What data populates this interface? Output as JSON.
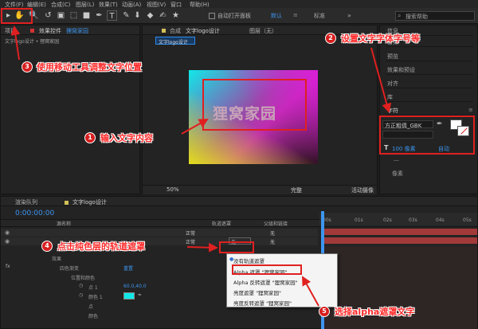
{
  "menubar": {
    "items": [
      "文件(F)",
      "编辑(E)",
      "合成(C)",
      "图层(L)",
      "效果(T)",
      "动画(A)",
      "视图(V)",
      "窗口",
      "帮助(H)"
    ]
  },
  "toolbar": {
    "auto_open_label": "自动打开面板",
    "workspace_default": "默认",
    "workspace_standard": "标准",
    "search_placeholder": "搜索帮助"
  },
  "project_panel": {
    "tab_project": "项目",
    "tab_effects": "效果控件",
    "tab_effects_target": "狸窝家园",
    "item": "文字logo设计 • 狸窝家园"
  },
  "comp_panel": {
    "tab": "合成",
    "comp_name": "文字logo设计",
    "layer_tab": "图层（无）",
    "breadcrumb": "文字logo设计",
    "canvas_text": "狸窝家园",
    "zoom": "50%",
    "quality": "完整",
    "camera": "活动摄像"
  },
  "right_panel": {
    "items": [
      "信息",
      "音频",
      "预览",
      "效果和预设",
      "对齐",
      "库"
    ],
    "char_title": "字符",
    "font_name": "方正粗倩_GBK",
    "font_size": "100 像素",
    "leading": "自动",
    "kerning_unit": "像素"
  },
  "timeline": {
    "tab_render": "渲染队列",
    "tab_comp": "文字logo设计",
    "timecode": "0:00:00:00",
    "col_source": "源名称",
    "col_trkmat": "轨道遮罩",
    "col_parent": "父级和链接",
    "mode_normal": "正常",
    "trkmat_none": "无",
    "parent_none": "无",
    "row_effect": "效果",
    "row_four_color": "四色渐变",
    "row_reset": "重置",
    "row_pos_color": "位置和颜色",
    "row_point1": "点 1",
    "row_point1_val": "60.0,40.0",
    "row_color1": "颜色 1",
    "row_point_short": "点",
    "row_color_short": "颜色",
    "ruler": [
      "00s",
      "01s",
      "02s",
      "03s",
      "04s",
      "05s"
    ]
  },
  "trkmat_menu": {
    "items": [
      "没有轨道遮罩",
      "Alpha 遮罩 \"狸窝家园\"",
      "Alpha 反转遮罩 \"狸窝家园\"",
      "亮度遮罩 \"狸窝家园\"",
      "亮度反转遮罩 \"狸窝家园\""
    ]
  },
  "annotations": {
    "a1": "输入文字内容",
    "a2": "设置文字字体字号等",
    "a3": "使用移动工具调整文字位置",
    "a4": "点击纯色层的轨道遮罩",
    "a5": "选择alpha遮罩文字"
  },
  "colors": {
    "annotation_red": "#e02020",
    "accent_blue": "#2d8ceb",
    "timeline_track_red": "#a23a3a"
  }
}
